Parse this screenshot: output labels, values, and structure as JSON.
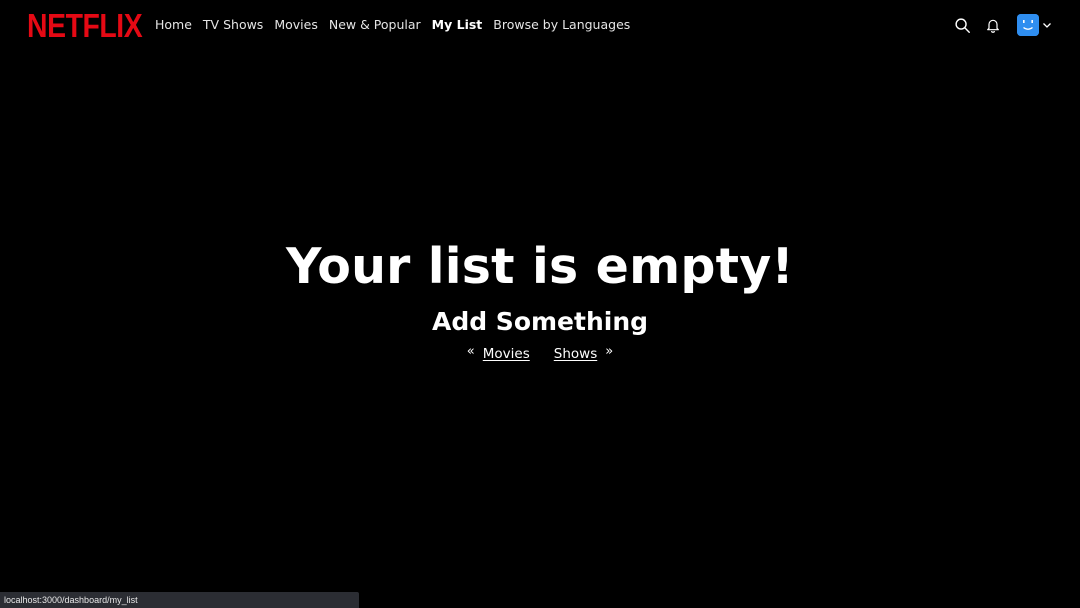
{
  "brand": {
    "logo_text": "NETFLIX",
    "color": "#E50914"
  },
  "nav": {
    "items": [
      {
        "label": "Home",
        "active": false
      },
      {
        "label": "TV Shows",
        "active": false
      },
      {
        "label": "Movies",
        "active": false
      },
      {
        "label": "New & Popular",
        "active": false
      },
      {
        "label": "My List",
        "active": true
      },
      {
        "label": "Browse by Languages",
        "active": false
      }
    ]
  },
  "header_icons": {
    "search": "search-icon",
    "notifications": "bell-icon",
    "avatar": "smiley-avatar-icon",
    "dropdown": "chevron-down-icon",
    "avatar_color": "#2f8ef0"
  },
  "main": {
    "title": "Your list is empty!",
    "subtitle": "Add Something",
    "links": {
      "movies_label": "Movies",
      "shows_label": "Shows",
      "movies_arrow": "«",
      "shows_arrow": "»"
    }
  },
  "status_bar": {
    "url": "localhost:3000/dashboard/my_list"
  }
}
